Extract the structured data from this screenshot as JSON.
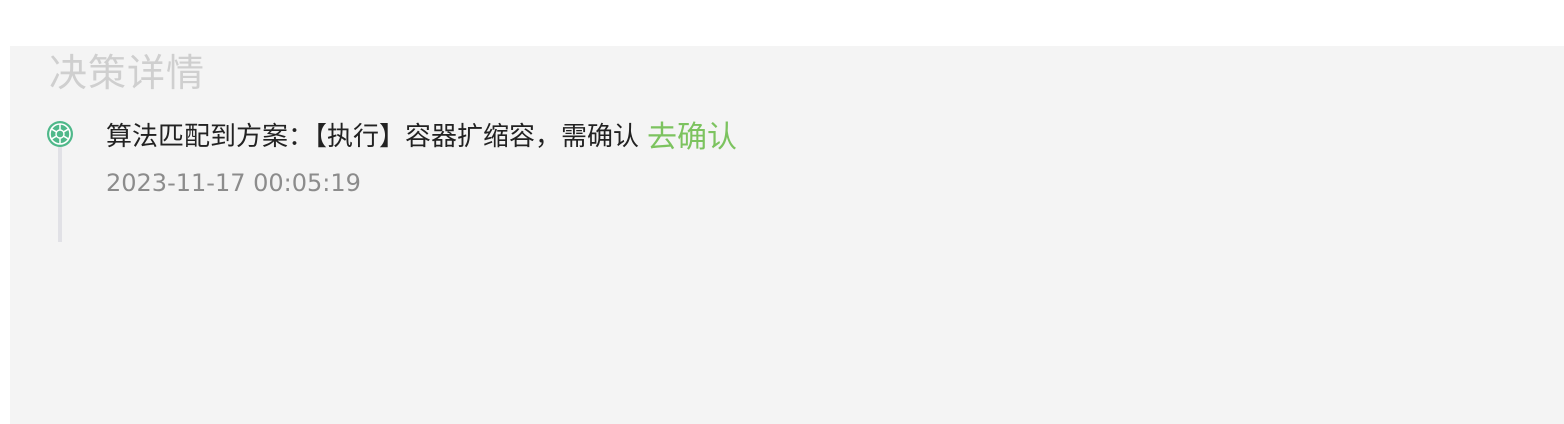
{
  "section": {
    "title": "决策详情"
  },
  "timeline": {
    "items": [
      {
        "message": "算法匹配到方案：【执行】容器扩缩容，需确认",
        "action_label": "去确认",
        "timestamp": "2023-11-17 00:05:19",
        "icon": "aperture-icon"
      }
    ]
  },
  "colors": {
    "panel_background": "#f4f4f4",
    "title": "#cfcfcf",
    "link": "#7cc35f",
    "dot": "#4fb88a",
    "line": "#e1e1e6",
    "timestamp": "#8c8c8c"
  }
}
